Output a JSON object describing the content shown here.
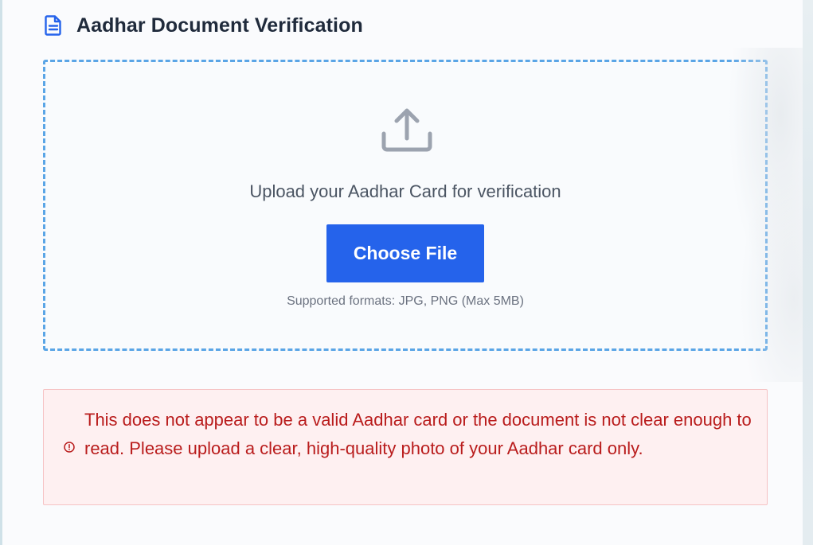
{
  "page": {
    "title": "Aadhar Document Verification",
    "title_icon": "document-icon"
  },
  "upload": {
    "icon": "upload-icon",
    "prompt": "Upload your Aadhar Card for verification",
    "button_label": "Choose File",
    "formats_note": "Supported formats: JPG, PNG (Max 5MB)"
  },
  "error": {
    "icon": "alert-circle-icon",
    "message": "This does not appear to be a valid Aadhar card or the document is not clear enough to read. Please upload a clear, high-quality photo of your Aadhar card only."
  },
  "colors": {
    "accent": "#2563eb",
    "dashed_border": "#5aa5e6",
    "error_text": "#b91c1c",
    "error_bg": "#fef0f1",
    "title_text": "#1f2a3b"
  }
}
